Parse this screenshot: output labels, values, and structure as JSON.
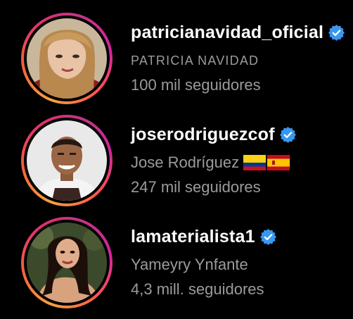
{
  "accounts": [
    {
      "username": "patricianavidad_oficial",
      "full_name": "PATRICIA NAVIDAD",
      "followers": "100 mil seguidores",
      "verified": true,
      "flags": []
    },
    {
      "username": "joserodriguezcof",
      "full_name": "Jose Rodríguez",
      "followers": "247 mil seguidores",
      "verified": true,
      "flags": [
        "colombia-flag-icon",
        "spain-flag-icon"
      ]
    },
    {
      "username": "lamaterialista1",
      "full_name": "Yameyry Ynfante",
      "followers": "4,3 mill. seguidores",
      "verified": true,
      "flags": []
    }
  ],
  "colors": {
    "background": "#000000",
    "username": "#ffffff",
    "secondary_text": "#9b9b9b",
    "verified_badge": "#3897f0",
    "story_ring_start": "#f9a03c",
    "story_ring_end": "#d6249f"
  }
}
